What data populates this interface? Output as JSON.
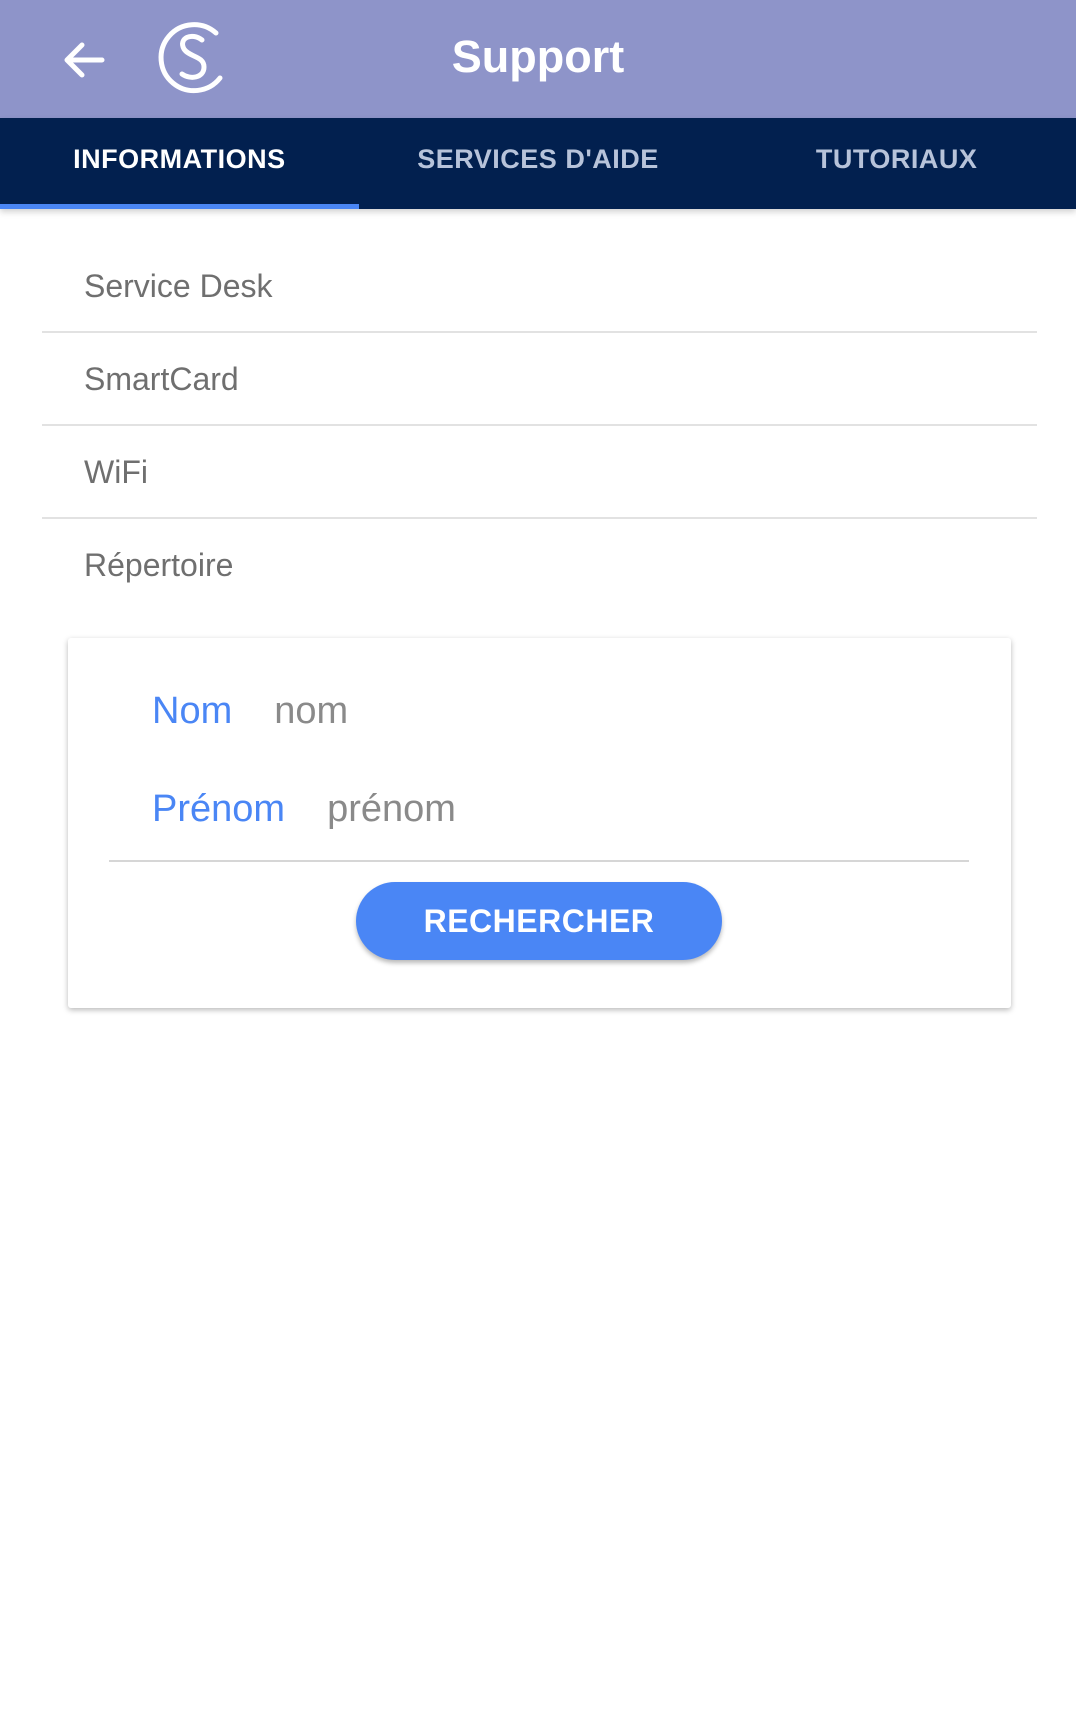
{
  "app_bar": {
    "title": "Support",
    "back_icon": "arrow-left-icon",
    "logo_icon": "swirl-s-logo",
    "background_color": "#8e94c9"
  },
  "tabs": [
    {
      "label": "INFORMATIONS",
      "active": true
    },
    {
      "label": "SERVICES D'AIDE",
      "active": false
    },
    {
      "label": "TUTORIAUX",
      "active": false
    }
  ],
  "tab_bar_color": "#02204f",
  "accent_color": "#4a86f5",
  "list": {
    "items": [
      {
        "label": "Service Desk"
      },
      {
        "label": "SmartCard"
      },
      {
        "label": "WiFi"
      },
      {
        "label": "Répertoire"
      }
    ]
  },
  "search_form": {
    "nom_label": "Nom",
    "nom_placeholder": "nom",
    "prenom_label": "Prénom",
    "prenom_placeholder": "prénom",
    "button_label": "RECHERCHER"
  }
}
